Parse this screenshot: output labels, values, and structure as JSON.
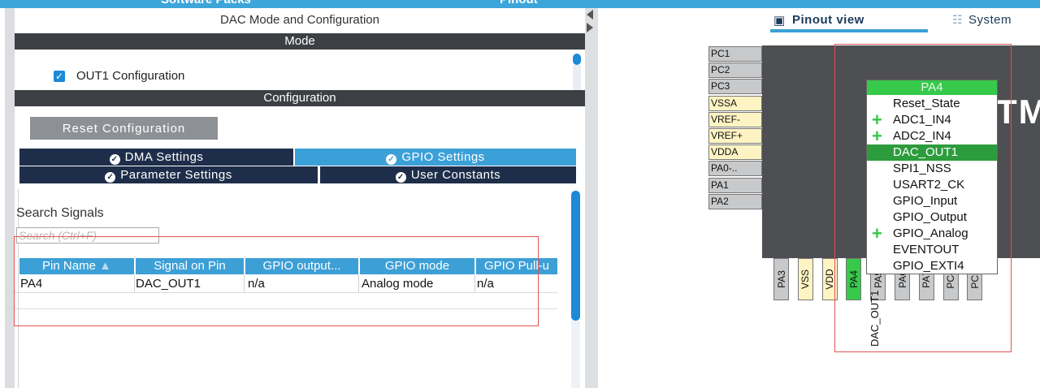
{
  "top": {
    "left_title": "Software Packs",
    "right_title": "Pinout"
  },
  "dac_panel": {
    "title": "DAC Mode and Configuration",
    "mode_header": "Mode",
    "out1_label": "OUT1 Configuration",
    "config_header": "Configuration",
    "reset_button": "Reset Configuration",
    "tabs": {
      "dma": "DMA Settings",
      "gpio": "GPIO Settings",
      "parameter": "Parameter Settings",
      "user": "User Constants"
    },
    "search_label": "Search Signals",
    "search_placeholder": "Search (Ctrl+F)",
    "table": {
      "headers": [
        "Pin Name",
        "Signal on Pin",
        "GPIO output...",
        "GPIO mode",
        "GPIO Pull-u"
      ],
      "rows": [
        [
          "PA4",
          "DAC_OUT1",
          "n/a",
          "Analog mode",
          "n/a"
        ]
      ]
    }
  },
  "pinout": {
    "view_tabs": [
      "Pinout view",
      "System"
    ],
    "chip_text": "TM",
    "left_pins": [
      {
        "name": "PC1",
        "color": "#c8c9cb"
      },
      {
        "name": "PC2",
        "color": "#c8c9cb"
      },
      {
        "name": "PC3",
        "color": "#c8c9cb"
      },
      {
        "name": "VSSA",
        "color": "#fef4c3"
      },
      {
        "name": "VREF-",
        "color": "#fef4c3"
      },
      {
        "name": "VREF+",
        "color": "#fef4c3"
      },
      {
        "name": "VDDA",
        "color": "#fef4c3"
      },
      {
        "name": "PA0-..",
        "color": "#c8c9cb"
      },
      {
        "name": "PA1",
        "color": "#c8c9cb"
      },
      {
        "name": "PA2",
        "color": "#c8c9cb"
      }
    ],
    "bottom_pins": [
      {
        "name": "PA3",
        "color": "#c8c9cb"
      },
      {
        "name": "VSS",
        "color": "#fef4c3"
      },
      {
        "name": "VDD",
        "color": "#fef4c3"
      },
      {
        "name": "PA4",
        "color": "#36c94a"
      },
      {
        "name": "PA5",
        "color": "#c8c9cb"
      },
      {
        "name": "PA6",
        "color": "#c8c9cb"
      },
      {
        "name": "PA7",
        "color": "#c8c9cb"
      },
      {
        "name": "PC4",
        "color": "#c8c9cb"
      },
      {
        "name": "PC5",
        "color": "#c8c9cb"
      }
    ],
    "pin_signal": "DAC_OUT1",
    "menu": {
      "title": "PA4",
      "items": [
        {
          "label": "Reset_State",
          "plus": false,
          "selected": false
        },
        {
          "label": "ADC1_IN4",
          "plus": true,
          "selected": false
        },
        {
          "label": "ADC2_IN4",
          "plus": true,
          "selected": false
        },
        {
          "label": "DAC_OUT1",
          "plus": false,
          "selected": true
        },
        {
          "label": "SPI1_NSS",
          "plus": false,
          "selected": false
        },
        {
          "label": "USART2_CK",
          "plus": false,
          "selected": false
        },
        {
          "label": "GPIO_Input",
          "plus": false,
          "selected": false
        },
        {
          "label": "GPIO_Output",
          "plus": false,
          "selected": false
        },
        {
          "label": "GPIO_Analog",
          "plus": true,
          "selected": false
        },
        {
          "label": "EVENTOUT",
          "plus": false,
          "selected": false
        },
        {
          "label": "GPIO_EXTI4",
          "plus": false,
          "selected": false
        }
      ]
    }
  },
  "colors": {
    "accent": "#3c9fd6",
    "dark_bar": "#3c3f44",
    "navy_tab": "#1e2e4a",
    "pin_green": "#36c94a",
    "highlight_red": "#e15252"
  }
}
